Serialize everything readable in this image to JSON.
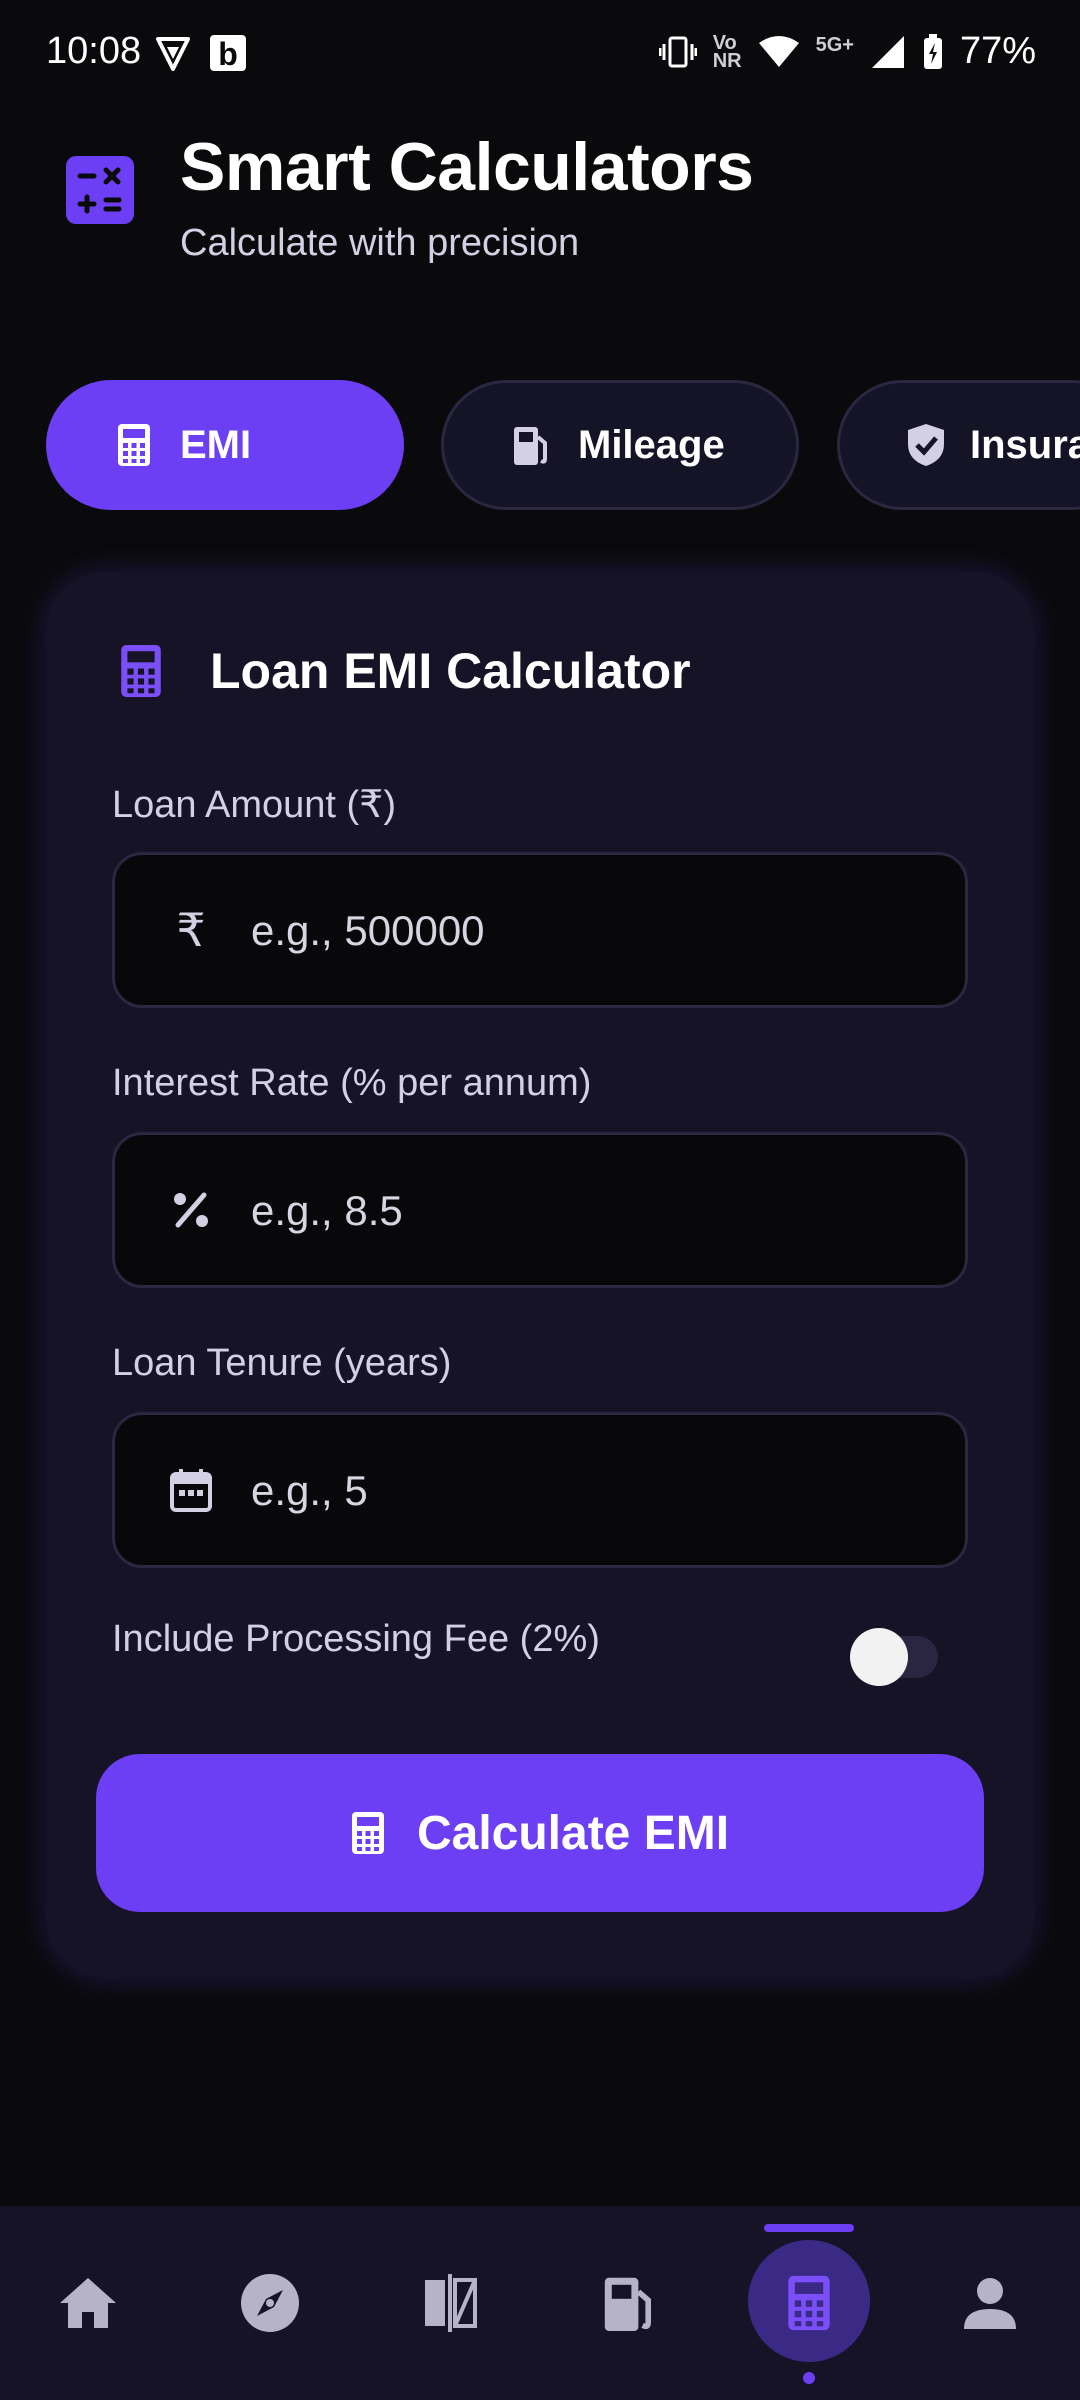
{
  "status_bar": {
    "time": "10:08",
    "battery": "77%",
    "network": "5G+",
    "volte": "Vo\nNR"
  },
  "header": {
    "title": "Smart Calculators",
    "subtitle": "Calculate with precision"
  },
  "tabs": [
    {
      "label": "EMI",
      "icon": "calculator-icon",
      "active": true
    },
    {
      "label": "Mileage",
      "icon": "fuel-pump-icon",
      "active": false
    },
    {
      "label": "Insurance",
      "icon": "shield-check-icon",
      "active": false
    }
  ],
  "card": {
    "title": "Loan EMI Calculator",
    "fields": [
      {
        "label": "Loan Amount (₹)",
        "placeholder": "e.g., 500000",
        "icon": "rupee-icon",
        "value": ""
      },
      {
        "label": "Interest Rate (% per annum)",
        "placeholder": "e.g., 8.5",
        "icon": "percent-icon",
        "value": ""
      },
      {
        "label": "Loan Tenure (years)",
        "placeholder": "e.g., 5",
        "icon": "calendar-icon",
        "value": ""
      }
    ],
    "toggle": {
      "label": "Include Processing Fee (2%)",
      "on": false
    },
    "button_label": "Calculate EMI"
  },
  "bottom_nav": [
    {
      "name": "home",
      "icon": "home-icon",
      "active": false
    },
    {
      "name": "explore",
      "icon": "compass-icon",
      "active": false
    },
    {
      "name": "compare",
      "icon": "compare-icon",
      "active": false
    },
    {
      "name": "fuel",
      "icon": "fuel-pump-icon",
      "active": false
    },
    {
      "name": "calculators",
      "icon": "calculator-icon",
      "active": true
    },
    {
      "name": "profile",
      "icon": "person-icon",
      "active": false
    }
  ],
  "colors": {
    "accent": "#6c3ff5",
    "background": "#0a0a0d",
    "card": "#161326"
  }
}
